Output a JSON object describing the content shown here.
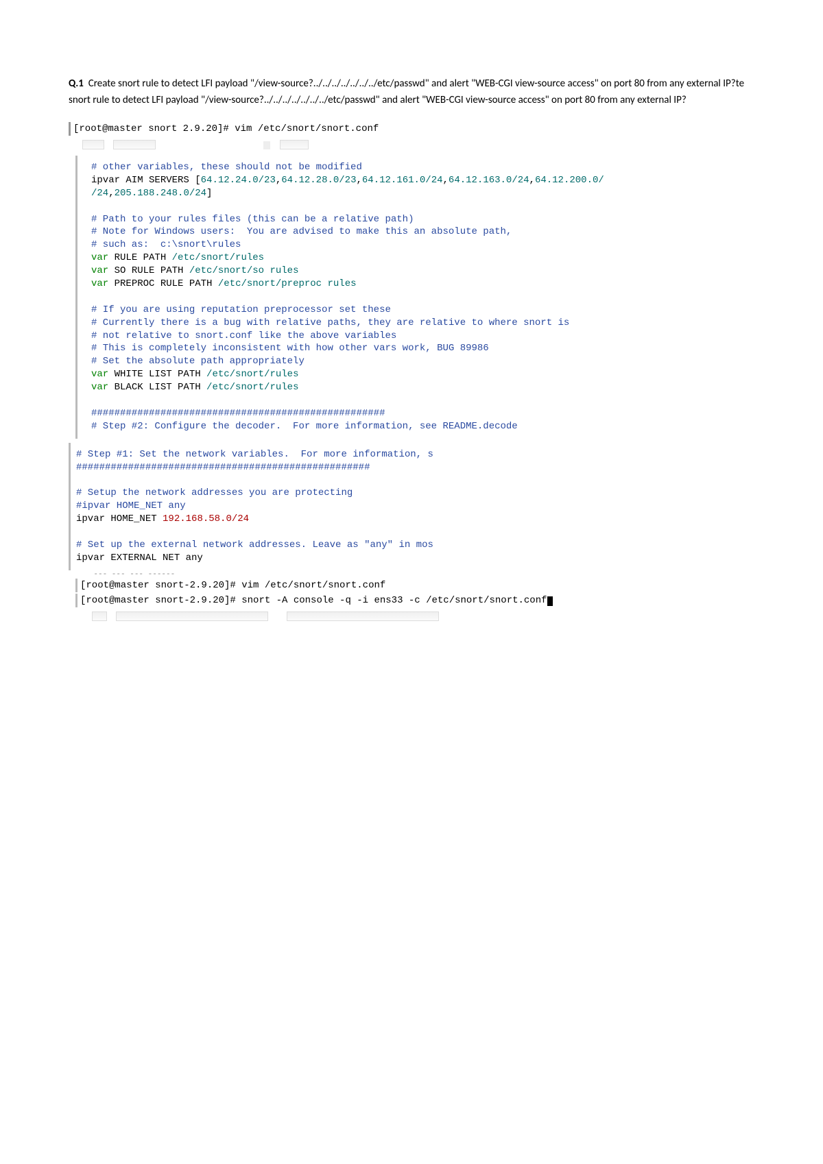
{
  "question": {
    "label": "Q.1",
    "text": "Create snort rule to detect LFI payload \"/view-source?../../../../../../../etc/passwd\" and alert \"WEB-CGI view-source access\" on port 80 from any external IP?te snort rule to detect LFI payload \"/view-source?../../../../../../../etc/passwd\" and alert \"WEB-CGI view-source access\" on port 80 from any external IP?"
  },
  "terminal1": {
    "prompt": "[root@master snort 2.9.20]# vim /etc/snort/snort.conf"
  },
  "editor1": {
    "lines": [
      {
        "cls": "comment",
        "t": "# other variables, these should not be modified"
      },
      {
        "cls": "",
        "t": "ipvar AIM SERVERS [64.12.24.0/23,64.12.28.0/23,64.12.161.0/24,64.12.163.0/24,64.12.200.0/",
        "spans": [
          {
            "cls": "",
            "t": "ipvar AIM SERVERS ["
          },
          {
            "cls": "val-teal",
            "t": "64.12.24.0/23"
          },
          {
            "cls": "",
            "t": ","
          },
          {
            "cls": "val-teal",
            "t": "64.12.28.0/23"
          },
          {
            "cls": "",
            "t": ","
          },
          {
            "cls": "val-teal",
            "t": "64.12.161.0/24"
          },
          {
            "cls": "",
            "t": ","
          },
          {
            "cls": "val-teal",
            "t": "64.12.163.0/24"
          },
          {
            "cls": "",
            "t": ","
          },
          {
            "cls": "val-teal",
            "t": "64.12.200.0/"
          }
        ]
      },
      {
        "cls": "",
        "spans": [
          {
            "cls": "val-teal",
            "t": "/24"
          },
          {
            "cls": "",
            "t": ","
          },
          {
            "cls": "val-teal",
            "t": "205.188.248.0/24"
          },
          {
            "cls": "",
            "t": "]"
          }
        ]
      },
      {
        "cls": "",
        "t": ""
      },
      {
        "cls": "comment",
        "t": "# Path to your rules files (this can be a relative path)"
      },
      {
        "cls": "comment",
        "t": "# Note for Windows users:  You are advised to make this an absolute path,"
      },
      {
        "cls": "comment",
        "t": "# such as:  c:\\snort\\rules"
      },
      {
        "cls": "",
        "spans": [
          {
            "cls": "keyword",
            "t": "var"
          },
          {
            "cls": "",
            "t": " RULE PATH "
          },
          {
            "cls": "val-teal",
            "t": "/etc/snort/rules"
          }
        ]
      },
      {
        "cls": "",
        "spans": [
          {
            "cls": "keyword",
            "t": "var"
          },
          {
            "cls": "",
            "t": " SO RULE PATH "
          },
          {
            "cls": "val-teal",
            "t": "/etc/snort/so rules"
          }
        ]
      },
      {
        "cls": "",
        "spans": [
          {
            "cls": "keyword",
            "t": "var"
          },
          {
            "cls": "",
            "t": " PREPROC RULE PATH "
          },
          {
            "cls": "val-teal",
            "t": "/etc/snort/preproc rules"
          }
        ]
      },
      {
        "cls": "",
        "t": ""
      },
      {
        "cls": "comment",
        "t": "# If you are using reputation preprocessor set these"
      },
      {
        "cls": "comment",
        "t": "# Currently there is a bug with relative paths, they are relative to where snort is"
      },
      {
        "cls": "comment",
        "t": "# not relative to snort.conf like the above variables"
      },
      {
        "cls": "comment",
        "t": "# This is completely inconsistent with how other vars work, BUG 89986"
      },
      {
        "cls": "comment",
        "t": "# Set the absolute path appropriately"
      },
      {
        "cls": "",
        "spans": [
          {
            "cls": "keyword",
            "t": "var"
          },
          {
            "cls": "",
            "t": " WHITE LIST PATH "
          },
          {
            "cls": "val-teal",
            "t": "/etc/snort/rules"
          }
        ]
      },
      {
        "cls": "",
        "spans": [
          {
            "cls": "keyword",
            "t": "var"
          },
          {
            "cls": "",
            "t": " BLACK LIST PATH "
          },
          {
            "cls": "val-teal",
            "t": "/etc/snort/rules"
          }
        ]
      },
      {
        "cls": "",
        "t": ""
      },
      {
        "cls": "comment",
        "t": "###################################################"
      },
      {
        "cls": "comment",
        "t": "# Step #2: Configure the decoder.  For more information, see README.decode"
      }
    ]
  },
  "editor2": {
    "lines": [
      {
        "cls": "comment",
        "t": "# Step #1: Set the network variables.  For more information, s"
      },
      {
        "cls": "comment",
        "t": "###################################################"
      },
      {
        "cls": "",
        "t": ""
      },
      {
        "cls": "comment",
        "t": "# Setup the network addresses you are protecting"
      },
      {
        "cls": "comment",
        "t": "#ipvar HOME_NET any"
      },
      {
        "cls": "",
        "spans": [
          {
            "cls": "",
            "t": "ipvar HOME_NET "
          },
          {
            "cls": "val-red",
            "t": "192.168.58.0/24"
          }
        ]
      },
      {
        "cls": "",
        "t": ""
      },
      {
        "cls": "comment",
        "t": "# Set up the external network addresses. Leave as \"any\" in mos"
      },
      {
        "cls": "",
        "t": "ipvar EXTERNAL NET any"
      }
    ]
  },
  "terminal2": {
    "line1": "[root@master snort-2.9.20]# vim /etc/snort/snort.conf",
    "line2": "[root@master snort-2.9.20]# snort -A console -q -i ens33 -c /etc/snort/snort.conf"
  }
}
